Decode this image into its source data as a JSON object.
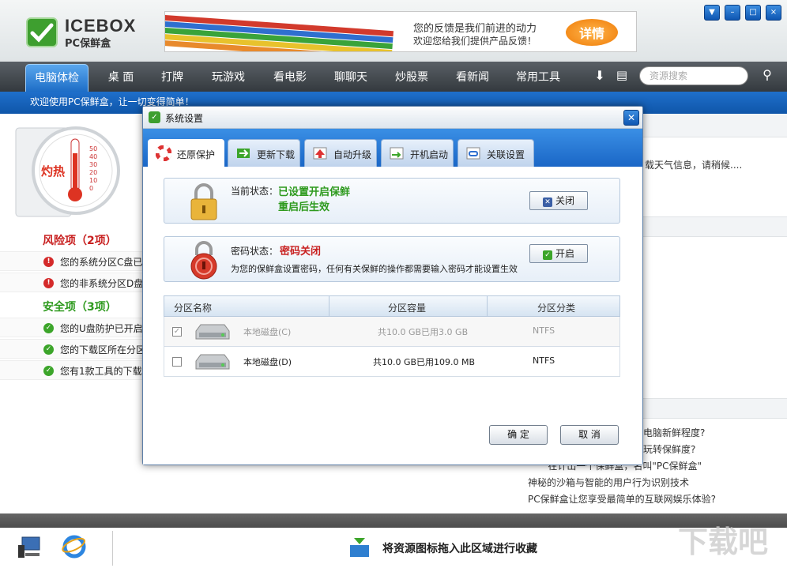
{
  "app": {
    "name": "ICEBOX",
    "subtitle": "PC保鲜盒"
  },
  "banner": {
    "line1": "您的反馈是我们前进的动力",
    "line2": "欢迎您给我们提供产品反馈！",
    "button": "详情"
  },
  "window_buttons": [
    "▼",
    "–",
    "□",
    "×"
  ],
  "nav": {
    "active": "电脑体检",
    "tabs": [
      "桌 面",
      "打牌",
      "玩游戏",
      "看电影",
      "聊聊天",
      "炒股票",
      "看新闻",
      "常用工具"
    ],
    "search_placeholder": "资源搜索"
  },
  "subbar": {
    "text": "欢迎使用PC保鲜盒，让一切变得简单！"
  },
  "thermo": {
    "label": "灼热",
    "ticks": [
      "50",
      "40",
      "30",
      "20",
      "10",
      "0"
    ]
  },
  "checkup": {
    "risk_title": "风险项（2项）",
    "risk_items": [
      "您的系统分区C盘已",
      "您的非系统分区D盘"
    ],
    "safe_title": "安全项（3项）",
    "safe_items": [
      "您的U盘防护已开启",
      "您的下载区所在分区",
      "您有1款工具的下载"
    ]
  },
  "right_panel": {
    "weather": "载天气信息，请稍候....",
    "links": [
      "电脑新鲜程度?",
      "玩转保鲜度?",
      "在计出一个保鲜盒，名叫\"PC保鲜盒\"",
      "神秘的沙箱与智能的用户行为识别技术",
      "PC保鲜盒让您享受最简单的互联网娱乐体验?"
    ]
  },
  "dock": {
    "text": "将资源图标拖入此区域进行收藏"
  },
  "watermark": "下载吧",
  "dialog": {
    "title": "系统设置",
    "tabs": [
      "还原保护",
      "更新下载",
      "自动升级",
      "开机启动",
      "关联设置"
    ],
    "protect": {
      "label": "当前状态：",
      "status1": "已设置开启保鲜",
      "status2": "重启后生效",
      "button": "关闭"
    },
    "password": {
      "label": "密码状态：",
      "status": "密码关闭",
      "desc": "为您的保鲜盒设置密码，任何有关保鲜的操作都需要输入密码才能设置生效",
      "button": "开启"
    },
    "table": {
      "headers": [
        "分区名称",
        "分区容量",
        "分区分类"
      ],
      "rows": [
        {
          "name": "本地磁盘(C)",
          "size": "共10.0 GB已用3.0 GB",
          "type": "NTFS",
          "checked": true
        },
        {
          "name": "本地磁盘(D)",
          "size": "共10.0 GB已用109.0 MB",
          "type": "NTFS",
          "checked": false
        }
      ]
    },
    "ok": "确 定",
    "cancel": "取 消"
  }
}
